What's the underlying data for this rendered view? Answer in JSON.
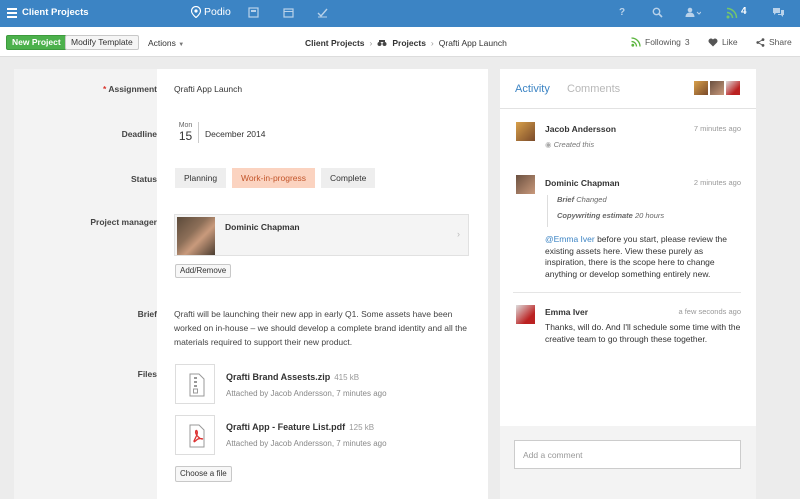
{
  "topbar": {
    "workspace": "Client Projects",
    "logo": "Podio",
    "notif_count": "4",
    "colors": {
      "bar": "#3c84c4"
    }
  },
  "actionbar": {
    "new_label": "New Project",
    "template_label": "Modify Template",
    "actions_label": "Actions",
    "breadcrumb": [
      "Client Projects",
      "Projects",
      "Qrafti App Launch"
    ],
    "following_label": "Following",
    "following_count": "3",
    "like_label": "Like",
    "share_label": "Share"
  },
  "fields": {
    "assignment_label": "Assignment",
    "assignment_value": "Qrafti App Launch",
    "deadline_label": "Deadline",
    "deadline_dow": "Mon",
    "deadline_day": "15",
    "deadline_month": "December 2014",
    "status_label": "Status",
    "status_options": [
      "Planning",
      "Work-in-progress",
      "Complete"
    ],
    "status_selected": "Work-in-progress",
    "pm_label": "Project manager",
    "pm_name": "Dominic Chapman",
    "add_remove_label": "Add/Remove",
    "brief_label": "Brief",
    "brief_text": "Qrafti will be launching their new app in early Q1. Some assets have been worked on in-house – we should develop a complete brand identity and all the materials required to support their new product.",
    "files_label": "Files",
    "files": [
      {
        "name": "Qrafti Brand Assests.zip",
        "size": "415 kB",
        "meta": "Attached by Jacob Andersson, 7 minutes ago",
        "icon": "zip-file-icon"
      },
      {
        "name": "Qrafti App - Feature List.pdf",
        "size": "125 kB",
        "meta": "Attached by Jacob Andersson, 7 minutes ago",
        "icon": "pdf-file-icon"
      }
    ],
    "choose_file_label": "Choose a file"
  },
  "activity": {
    "tab_activity": "Activity",
    "tab_comments": "Comments",
    "items": [
      {
        "name": "Jacob Andersson",
        "time": "7 minutes ago",
        "line": "Created this"
      },
      {
        "name": "Dominic Chapman",
        "time": "2 minutes ago",
        "change1_field": "Brief",
        "change1_text": "Changed",
        "change2_field": "Copywriting estimate",
        "change2_text": "20 hours",
        "mention": "@Emma Iver",
        "text": " before you start, please review the existing assets here. View these purely as inspiration, there is the scope here to change anything or develop something entirely new."
      },
      {
        "name": "Emma Iver",
        "time": "a few seconds ago",
        "text": "Thanks, will do. And I'll schedule some time with the creative team to go through these together."
      }
    ],
    "comment_placeholder": "Add a comment"
  }
}
